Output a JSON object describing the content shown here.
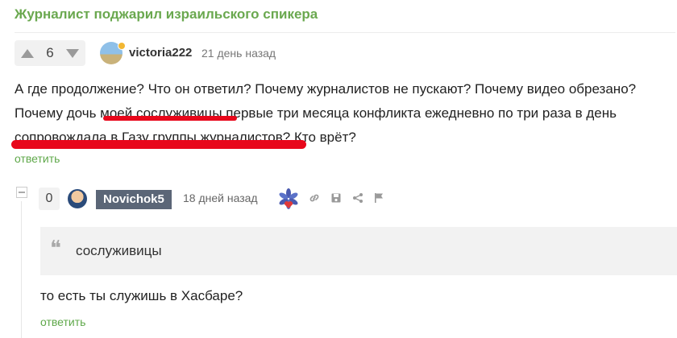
{
  "post": {
    "title": "Журналист поджарил израильского спикера"
  },
  "comment1": {
    "votes": "6",
    "username": "victoria222",
    "time": "21 день назад",
    "text_line1": "А где продолжение? Что он ответил? Почему журналистов не пускают? Почему видео обрезано?",
    "text_line2": "Почему дочь моей сослуживицы первые три месяца конфликта ежедневно по три раза в день",
    "text_line3": "сопровождала в Газу группы журналистов? Кто врёт?",
    "reply_label": "ответить"
  },
  "comment2": {
    "votes": "0",
    "username": "Novichok5",
    "time": "18 дней назад",
    "quote": "сослуживицы",
    "text": "то есть ты служишь в Хасбаре?",
    "reply_label": "ответить"
  },
  "icons": {
    "upvote": "arrow-up-icon",
    "downvote": "arrow-down-icon",
    "link": "link-icon",
    "save": "save-icon",
    "share": "share-icon",
    "flag": "flag-icon",
    "badge": "flower-badge-icon"
  },
  "colors": {
    "accent_green": "#6aa84f",
    "highlight_red": "#e8071b",
    "username_badge_bg": "#5b6677"
  }
}
